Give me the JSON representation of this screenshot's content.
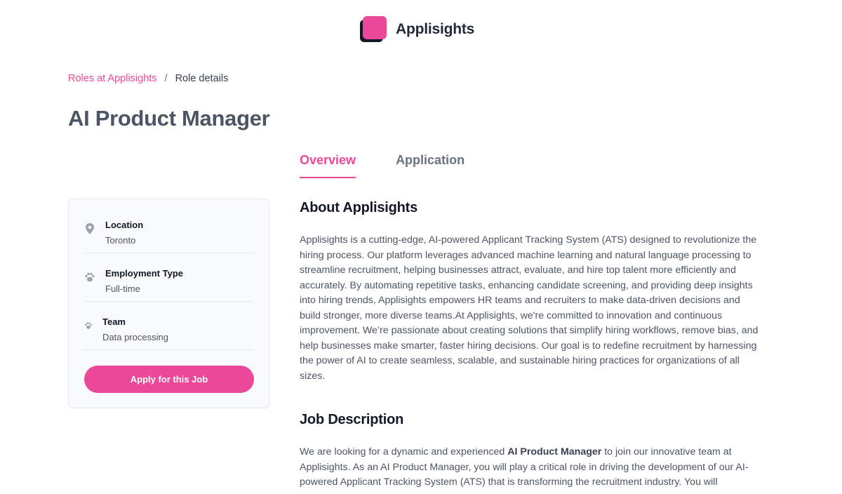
{
  "brand": {
    "name": "Applisights",
    "accent": "#ec4899",
    "logo_icon": "stacked-squares-logo"
  },
  "breadcrumb": {
    "parent": "Roles at Applisights",
    "separator": "/",
    "current": "Role details"
  },
  "page_title": "AI Product Manager",
  "tabs": [
    {
      "label": "Overview",
      "active": true
    },
    {
      "label": "Application",
      "active": false
    }
  ],
  "sidebar": {
    "items": [
      {
        "icon": "location-pin-icon",
        "label": "Location",
        "value": "Toronto"
      },
      {
        "icon": "paw-icon",
        "label": "Employment Type",
        "value": "Full-time"
      },
      {
        "icon": "paw-icon",
        "label": "Team",
        "value": "Data processing"
      }
    ],
    "apply_label": "Apply for this Job"
  },
  "about": {
    "heading": "About Applisights",
    "text": "Applisights is a cutting-edge, AI-powered Applicant Tracking System (ATS) designed to revolutionize the hiring process. Our platform leverages advanced machine learning and natural language processing to streamline recruitment, helping businesses attract, evaluate, and hire top talent more efficiently and accurately. By automating repetitive tasks, enhancing candidate screening, and providing deep insights into hiring trends, Applisights empowers HR teams and recruiters to make data-driven decisions and build stronger, more diverse teams.At Applisights, we're committed to innovation and continuous improvement. We’re passionate about creating solutions that simplify hiring workflows, remove bias, and help businesses make smarter, faster hiring decisions. Our goal is to redefine recruitment by harnessing the power of AI to create seamless, scalable, and sustainable hiring practices for organizations of all sizes."
  },
  "job_description": {
    "heading": "Job Description",
    "intro_before": "We are looking for a dynamic and experienced ",
    "intro_bold": "AI Product Manager",
    "intro_after": " to join our innovative team at Applisights. As an AI Product Manager, you will play a critical role in driving the development of our AI-powered Applicant Tracking System (ATS) that is transforming the recruitment industry. You will"
  }
}
